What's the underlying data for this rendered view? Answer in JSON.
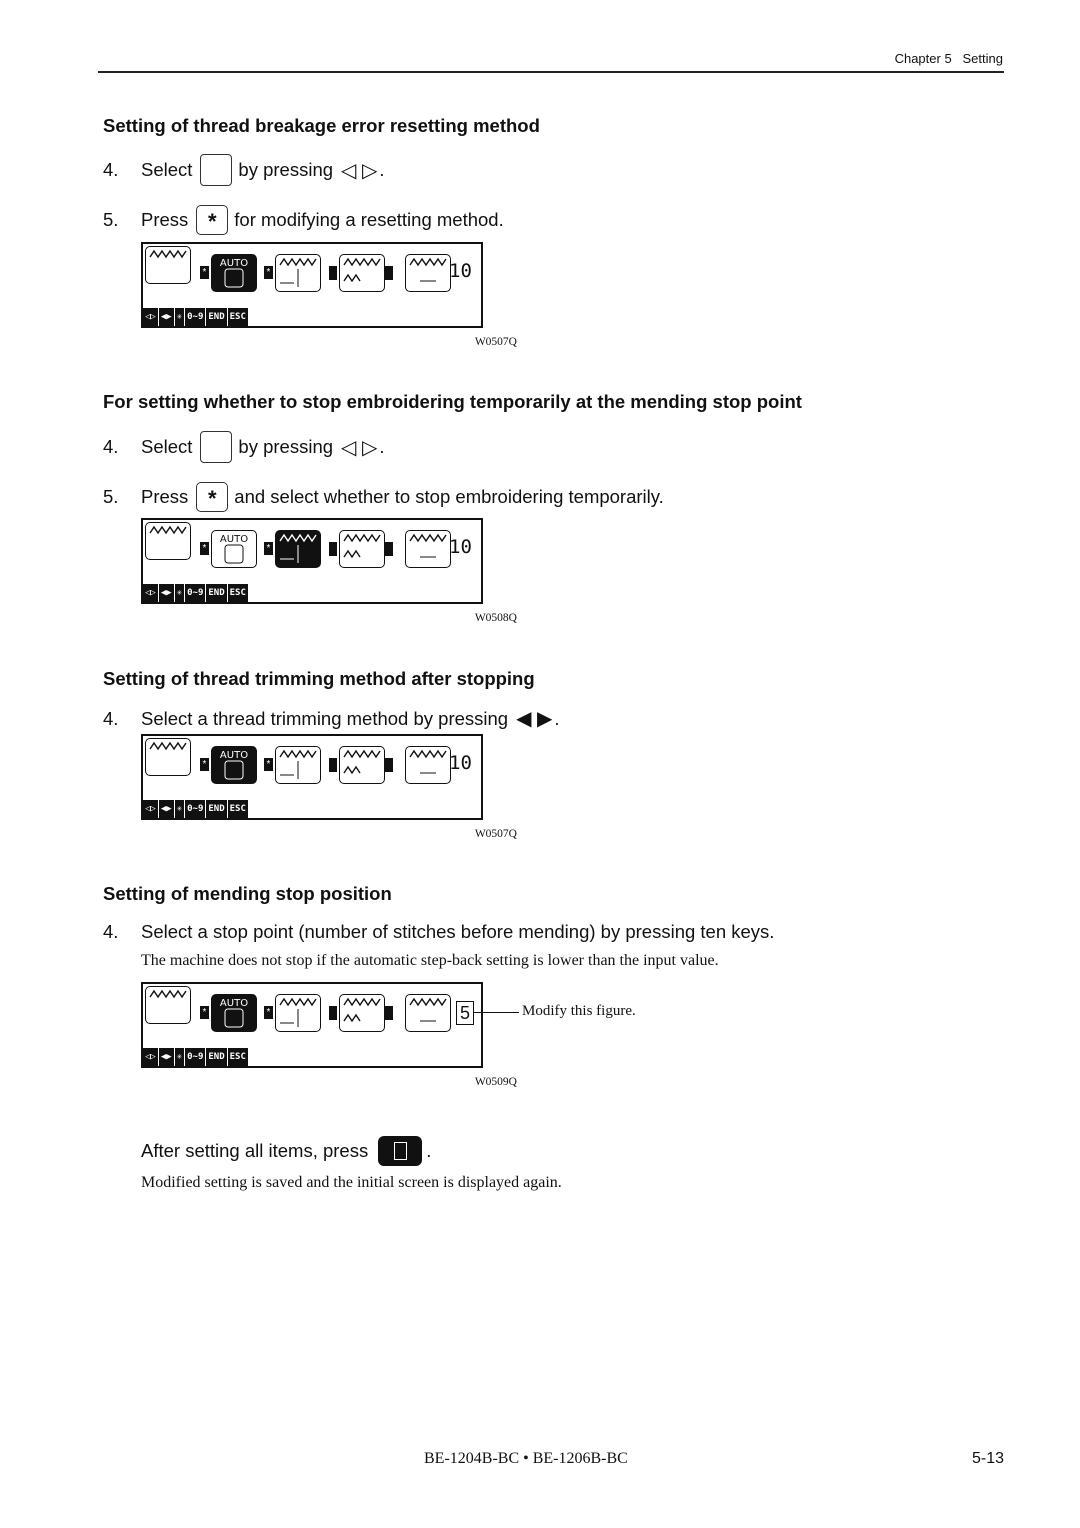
{
  "header": {
    "chapter": "Chapter 5",
    "section": "Setting"
  },
  "sections": [
    {
      "title": "Setting of thread breakage error resetting method",
      "steps": [
        {
          "num": "4.",
          "pre": "Select",
          "icon": "auto-reset-icon",
          "post": "by pressing",
          "keys": "◁ ▷",
          "end": "."
        },
        {
          "num": "5.",
          "pre": "Press",
          "key": "*",
          "post": "for modifying a resetting method."
        }
      ],
      "figure": {
        "caption": "W0507Q",
        "value": "10",
        "selected": "auto"
      }
    },
    {
      "title": "For setting whether to stop embroidering temporarily at the mending stop point",
      "steps": [
        {
          "num": "4.",
          "pre": "Select",
          "icon": "mending-stop-icon",
          "post": "by pressing",
          "keys": "◁ ▷",
          "end": "."
        },
        {
          "num": "5.",
          "pre": "Press",
          "key": "*",
          "post": "and select whether to stop embroidering temporarily."
        }
      ],
      "figure": {
        "caption": "W0508Q",
        "value": "10",
        "selected": "mending-stop"
      }
    },
    {
      "title": "Setting of thread trimming method after stopping",
      "steps": [
        {
          "num": "4.",
          "pre": "Select a thread trimming method by pressing",
          "keys": "◀ ▶",
          "end": "."
        }
      ],
      "figure": {
        "caption": "W0507Q",
        "value": "10",
        "selected": "auto"
      }
    },
    {
      "title": "Setting of mending stop position",
      "steps": [
        {
          "num": "4.",
          "pre": "Select a stop point (number of stitches before mending) by pressing ten keys."
        }
      ],
      "note": "The machine does not stop if the automatic step-back setting is lower than the input value.",
      "figure": {
        "caption": "W0509Q",
        "value": "5",
        "selected": "auto",
        "callout": "Modify this figure."
      }
    }
  ],
  "lcd_bar": [
    "◁▷",
    "◀▶",
    "✳",
    "0~9",
    "END",
    "ESC"
  ],
  "final": {
    "text": "After setting all items, press",
    "end": ".",
    "note": "Modified setting is saved and the initial screen is displayed again."
  },
  "footer": {
    "model": "BE-1204B-BC • BE-1206B-BC",
    "page": "5-13"
  }
}
